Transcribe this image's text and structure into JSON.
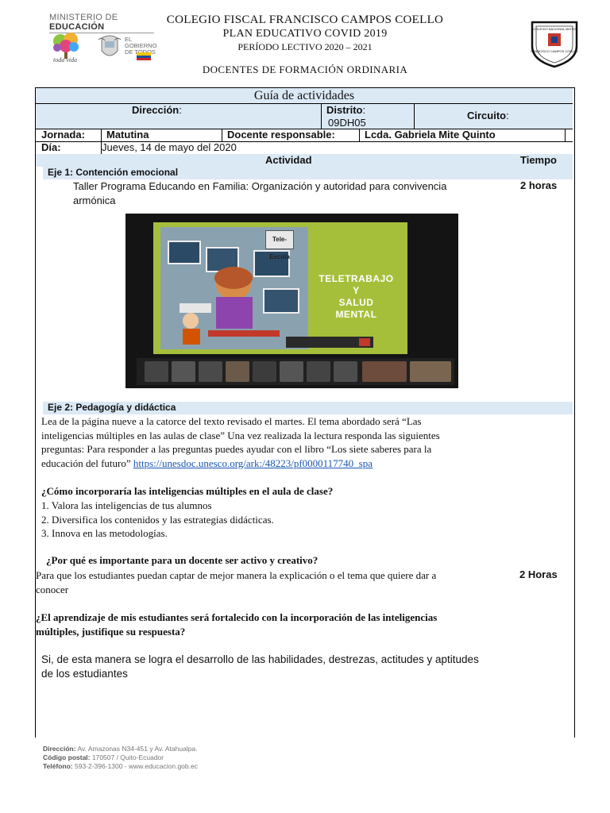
{
  "header": {
    "ministry_prefix": "MINISTERIO DE ",
    "ministry_strong": "EDUCACIÓN",
    "gov_line1": "EL",
    "gov_line2": "GOBIERNO",
    "gov_line3": "DE TODOS",
    "school_name": "COLEGIO FISCAL FRANCISCO CAMPOS COELLO",
    "plan": "PLAN EDUCATIVO COVID 2019",
    "period": "PERÍODO LECTIVO 2020 – 2021",
    "subtitle": "DOCENTES DE FORMACIÓN ORDINARIA",
    "crest_text_top": "COLEGIO NACIONAL MIXTO",
    "crest_text_bottom": "FRANCISCO CAMPOS COELLO"
  },
  "guide": {
    "title": "Guía de actividades",
    "direccion_label": "Dirección",
    "direccion_colon": ":",
    "distrito_label": "Distrito",
    "distrito_colon": ":",
    "distrito_value": "09DH05",
    "circuito_label": "Circuito",
    "circuito_colon": ":",
    "jornada_label": "Jornada:",
    "jornada_value": "Matutina",
    "docente_label": "Docente responsable:",
    "docente_value": "Lcda. Gabriela Mite Quinto",
    "dia_label": "Día:",
    "dia_value": "Jueves, 14 de mayo del 2020",
    "actividad_label": "Actividad",
    "tiempo_label": "Tiempo"
  },
  "eje1": {
    "title": "Eje 1: Contención emocional",
    "line1": "Taller Programa Educando en Familia: Organización y autoridad para convivencia",
    "line2": "armónica",
    "time": "2 horas",
    "image": {
      "badge": "Tele-Escola",
      "slide_line1": "TELETRABAJO",
      "slide_line2": "Y",
      "slide_line3": "SALUD",
      "slide_line4": "MENTAL"
    }
  },
  "eje2": {
    "title": "Eje 2: Pedagogía y didáctica",
    "p1_line1": "Lea de la página nueve a la catorce del texto revisado el martes. El tema abordado será “Las",
    "p1_line2": "inteligencias múltiples en las aulas de clase” Una vez realizada la lectura responda las siguientes",
    "p1_line3": "preguntas: Para responder a las preguntas puedes ayudar con el libro “Los siete saberes para la",
    "p1_line4": "educación del futuro”",
    "p1_link": "https://unesdoc.unesco.org/ark:/48223/pf0000117740_spa",
    "q1": "¿Cómo incorporaría las inteligencias múltiples en el aula de clase?",
    "a1_1": "1. Valora las inteligencias de tus alumnos",
    "a1_2": "2. Diversifica los contenidos y las estrategias didácticas.",
    "a1_3": "3. Innova en las metodologías.",
    "q2": "¿Por qué es importante para un docente ser activo y creativo?",
    "a2_line1": "Para que los estudiantes  puedan captar de mejor manera la explicación o el tema que quiere dar a",
    "a2_line2": "conocer",
    "time": "2 Horas",
    "q3_line1": "¿El aprendizaje de mis estudiantes será fortalecido con la incorporación de las inteligencias",
    "q3_line2": "múltiples, justifique su respuesta?",
    "a3_line1": "Si, de esta manera se logra el desarrollo de las habilidades, destrezas, actitudes y aptitudes",
    "a3_line2": "de los estudiantes"
  },
  "footer": {
    "dir_label": "Dirección:",
    "dir_value": " Av. Amazonas N34-451 y Av. Atahualpa.",
    "cp_label": "Código postal:",
    "cp_value": " 170507 / Quito-Ecuador",
    "tel_label": "Teléfono:",
    "tel_value": " 593-2-396-1300 - www.educacion.gob.ec"
  },
  "colors": {
    "header_fill": "#dbe9f5",
    "link": "#1a55b3",
    "slide_green": "#a6bf3a"
  }
}
